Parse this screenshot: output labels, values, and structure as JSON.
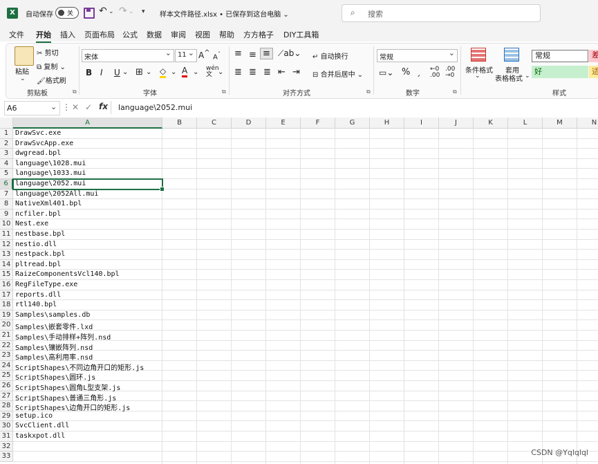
{
  "titlebar": {
    "autosave_label": "自动保存",
    "toggle_state": "关",
    "document_title": "样本文件路径.xlsx • 已保存到这台电脑 ⌄",
    "search_placeholder": "搜索"
  },
  "menu": {
    "tabs": [
      "文件",
      "开始",
      "插入",
      "页面布局",
      "公式",
      "数据",
      "审阅",
      "视图",
      "帮助",
      "方方格子",
      "DIY工具箱"
    ],
    "active_tab": "开始"
  },
  "ribbon": {
    "clipboard": {
      "label": "剪贴板",
      "paste": "粘贴",
      "cut": "剪切",
      "copy": "复制",
      "format_painter": "格式刷"
    },
    "font": {
      "label": "字体",
      "font_name": "宋体",
      "font_size": "11"
    },
    "alignment": {
      "label": "对齐方式",
      "wrap_text": "自动换行",
      "merge_center": "合并后居中"
    },
    "number": {
      "label": "数字",
      "format": "常规"
    },
    "styles": {
      "label": "样式",
      "conditional_format": "条件格式",
      "table_format_1": "套用",
      "table_format_2": "表格格式",
      "normal": "常规",
      "good": "好",
      "bad": "差",
      "neutral": "适"
    }
  },
  "formula_bar": {
    "name_box": "A6",
    "formula": "language\\2052.mui"
  },
  "sheet": {
    "columns": [
      "A",
      "B",
      "C",
      "D",
      "E",
      "F",
      "G",
      "H",
      "I",
      "J",
      "K",
      "L",
      "M",
      "N"
    ],
    "selected_column": "A",
    "selected_row": 6,
    "row_numbers": [
      "1",
      "2",
      "3",
      "4",
      "5",
      "6",
      "7",
      "8",
      "9",
      "10",
      "11",
      "12",
      "13",
      "14",
      "15",
      "16",
      "17",
      "18",
      "19",
      "20",
      "21",
      "22",
      "23",
      "24",
      "25",
      "26",
      "27",
      "28",
      "29",
      "30",
      "31",
      "32",
      "33"
    ],
    "cells_a": [
      "DrawSvc.exe",
      "DrawSvcApp.exe",
      "dwgread.bpl",
      "language\\1028.mui",
      "language\\1033.mui",
      "language\\2052.mui",
      "language\\2052All.mui",
      "NativeXml401.bpl",
      "ncfiler.bpl",
      "Nest.exe",
      "nestbase.bpl",
      "nestio.dll",
      "nestpack.bpl",
      "pltread.bpl",
      "RaizeComponentsVcl140.bpl",
      "RegFileType.exe",
      "reports.dll",
      "rtl140.bpl",
      "Samples\\samples.db",
      "Samples\\嵌套零件.lxd",
      "Samples\\手动排样+阵列.nsd",
      "Samples\\镶嵌阵列.nsd",
      "Samples\\高利用率.nsd",
      "ScriptShapes\\不同边角开口的矩形.js",
      "ScriptShapes\\圆环.js",
      "ScriptShapes\\圆角L型支架.js",
      "ScriptShapes\\普通三角形.js",
      "ScriptShapes\\边角开口的矩形.js",
      "setup.ico",
      "SvcClient.dll",
      "taskxpot.dll",
      "",
      ""
    ]
  },
  "watermark": "CSDN @Yqlqlql",
  "colors": {
    "accent": "#1d6f42",
    "good_fill": "#c6efce",
    "bad_fill": "#ffc7ce",
    "neutral_fill": "#ffeb9c"
  }
}
